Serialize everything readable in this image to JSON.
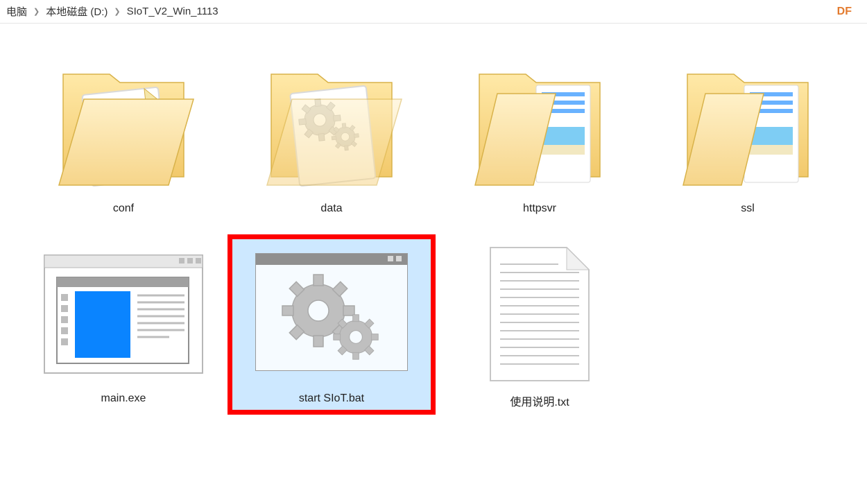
{
  "breadcrumb": {
    "crumb0": "电脑",
    "crumb1": "本地磁盘 (D:)",
    "crumb2": "SIoT_V2_Win_1113"
  },
  "badge": "DF",
  "items": {
    "conf": {
      "label": "conf",
      "kind": "folder-with-page"
    },
    "data": {
      "label": "data",
      "kind": "folder-with-gears"
    },
    "httpsvr": {
      "label": "httpsvr",
      "kind": "folder-open-pics"
    },
    "ssl": {
      "label": "ssl",
      "kind": "folder-open-pics"
    },
    "mainexe": {
      "label": "main.exe",
      "kind": "exe-window"
    },
    "startbat": {
      "label": "start SIoT.bat",
      "kind": "bat-gears"
    },
    "readme": {
      "label": "使用说明.txt",
      "kind": "text-file"
    }
  }
}
